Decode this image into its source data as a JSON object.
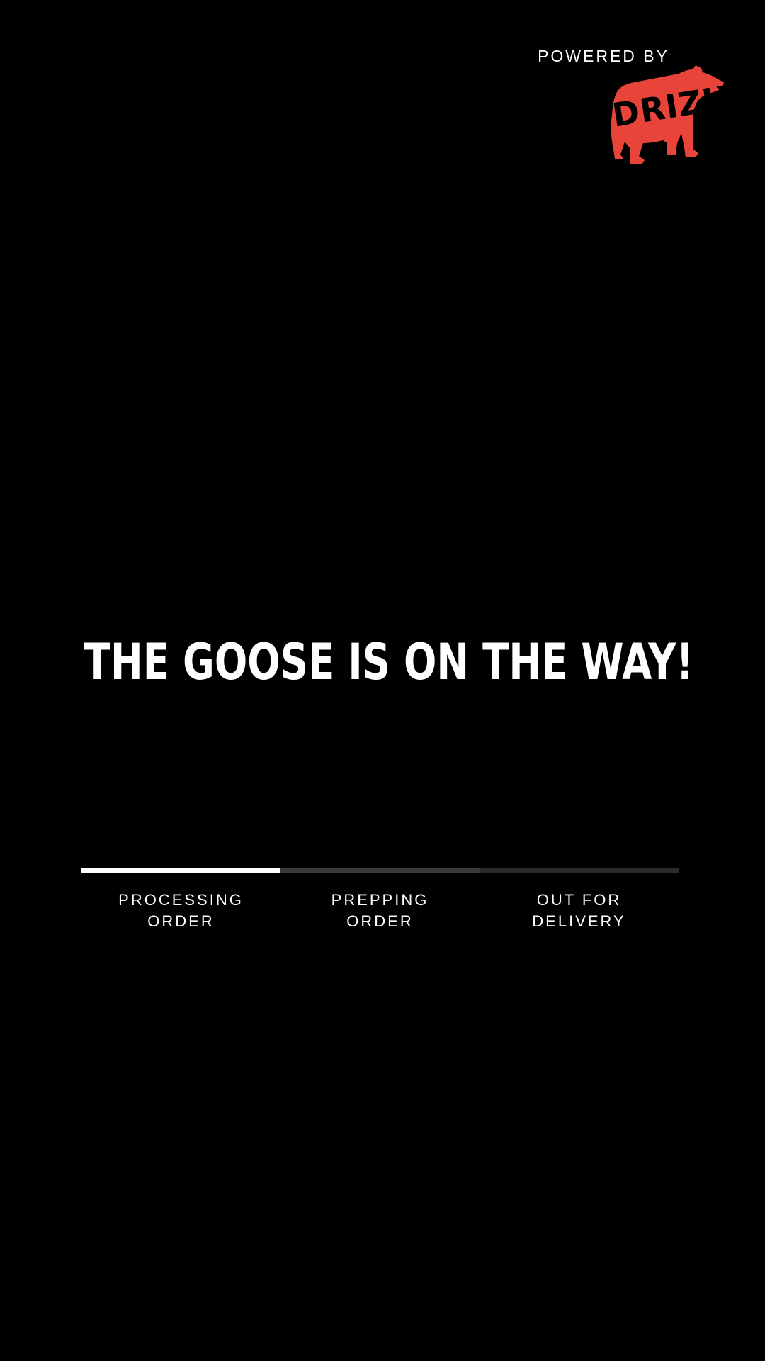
{
  "header": {
    "powered_by_label": "POWERED BY",
    "logo_text": "DRIZLY",
    "logo_color": "#e8443a"
  },
  "main": {
    "headline": "THE GOOSE IS ON THE WAY!"
  },
  "progress": {
    "current_step": 1,
    "total_steps": 3,
    "fraction_complete": 0.333,
    "colors": {
      "complete": "#ffffff",
      "next": "#3a3a3a",
      "pending": "#2a2a2a"
    },
    "steps": [
      {
        "label": "PROCESSING\nORDER"
      },
      {
        "label": "PREPPING\nORDER"
      },
      {
        "label": "OUT FOR\nDELIVERY"
      }
    ]
  }
}
